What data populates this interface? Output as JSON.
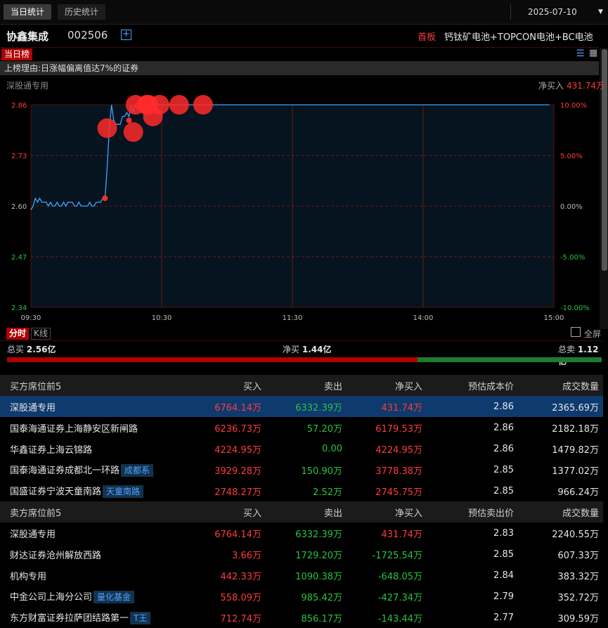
{
  "tabs": {
    "today": "当日统计",
    "history": "历史统计"
  },
  "date": "2025-07-10",
  "stock": {
    "name": "协鑫集成",
    "code": "002506",
    "board_label": "首板",
    "concepts": "钙钛矿电池+TOPCON电池+BC电池"
  },
  "list_tag": "当日榜",
  "reason": "上榜理由:日涨幅偏离值达7%的证券",
  "chart_header": {
    "trader": "深股通专用",
    "net_label": "净买入",
    "net_value": "431.74万"
  },
  "chart_data": {
    "type": "line",
    "x_ticks": [
      "09:30",
      "10:30",
      "11:30",
      "14:00",
      "15:00"
    ],
    "y_ticks_left": [
      "2.86",
      "2.73",
      "2.60",
      "2.47",
      "2.34"
    ],
    "y_ticks_right": [
      "10.00%",
      "5.00%",
      "0.00%",
      "-5.00%",
      "-10.00%"
    ],
    "ylim": [
      2.34,
      2.86
    ],
    "prev_close": 2.6,
    "series": [
      {
        "values": [
          2.59,
          2.6,
          2.62,
          2.61,
          2.62,
          2.61,
          2.61,
          2.61,
          2.6,
          2.61,
          2.6,
          2.6,
          2.61,
          2.6,
          2.6,
          2.61,
          2.6,
          2.61,
          2.61,
          2.61,
          2.6,
          2.6,
          2.61,
          2.6,
          2.6,
          2.6,
          2.6,
          2.61,
          2.6,
          2.6,
          2.61,
          2.61,
          2.61,
          2.62,
          2.62,
          2.7,
          2.8,
          2.86,
          2.82,
          2.81,
          2.81,
          2.81,
          2.83,
          2.83,
          2.84,
          2.83,
          2.86,
          2.84,
          2.86,
          2.85,
          2.86,
          2.85,
          2.86,
          2.86,
          2.86,
          2.86,
          2.85,
          2.86,
          2.86,
          2.86,
          2.86,
          2.86,
          2.86,
          2.86,
          2.86,
          2.86,
          2.86,
          2.86,
          2.86,
          2.86,
          2.86,
          2.86,
          2.86,
          2.86,
          2.86,
          2.86,
          2.86,
          2.86,
          2.86,
          2.86,
          2.86,
          2.86,
          2.86,
          2.86,
          2.86,
          2.86,
          2.86,
          2.86,
          2.86,
          2.86,
          2.86,
          2.86,
          2.86,
          2.86,
          2.86,
          2.86,
          2.86,
          2.86,
          2.86,
          2.86,
          2.86,
          2.86,
          2.86,
          2.86,
          2.86,
          2.86,
          2.86,
          2.86,
          2.86,
          2.86,
          2.86,
          2.86,
          2.86,
          2.86,
          2.86,
          2.86,
          2.86,
          2.86,
          2.86,
          2.86,
          2.86,
          2.86,
          2.86,
          2.86,
          2.86,
          2.86,
          2.86,
          2.86,
          2.86,
          2.86,
          2.86,
          2.86,
          2.86,
          2.86,
          2.86,
          2.86,
          2.86,
          2.86,
          2.86,
          2.86,
          2.86,
          2.86,
          2.86,
          2.86,
          2.86,
          2.86,
          2.86,
          2.86,
          2.86,
          2.86,
          2.86,
          2.86,
          2.86,
          2.86,
          2.86,
          2.86,
          2.86,
          2.86,
          2.86,
          2.86,
          2.86,
          2.86,
          2.86,
          2.86,
          2.86,
          2.86,
          2.86,
          2.86,
          2.86,
          2.86,
          2.86,
          2.86,
          2.86,
          2.86,
          2.86,
          2.86,
          2.86,
          2.86,
          2.86,
          2.86,
          2.86,
          2.86,
          2.86,
          2.86,
          2.86,
          2.86,
          2.86,
          2.86,
          2.86,
          2.86,
          2.86,
          2.86,
          2.86,
          2.86,
          2.86,
          2.86,
          2.86,
          2.86,
          2.86,
          2.86,
          2.86,
          2.86,
          2.86,
          2.86,
          2.86,
          2.86,
          2.86,
          2.86,
          2.86,
          2.86,
          2.86,
          2.86,
          2.86,
          2.86,
          2.86,
          2.86,
          2.86,
          2.86,
          2.86,
          2.86,
          2.86,
          2.86,
          2.86,
          2.86,
          2.86,
          2.86,
          2.86,
          2.86,
          2.86,
          2.86,
          2.86,
          2.86,
          2.86,
          2.86,
          2.86,
          2.86,
          2.86,
          2.86,
          2.86
        ]
      }
    ],
    "markers": [
      {
        "i": 34,
        "v": 2.62,
        "size": "s"
      },
      {
        "i": 35,
        "v": 2.8,
        "size": "l"
      },
      {
        "i": 45,
        "v": 2.82,
        "size": "s"
      },
      {
        "i": 47,
        "v": 2.79,
        "size": "l"
      },
      {
        "i": 48,
        "v": 2.86,
        "size": "l"
      },
      {
        "i": 53,
        "v": 2.86,
        "size": "l"
      },
      {
        "i": 54,
        "v": 2.86,
        "size": "l"
      },
      {
        "i": 56,
        "v": 2.83,
        "size": "l"
      },
      {
        "i": 59,
        "v": 2.86,
        "size": "l"
      },
      {
        "i": 68,
        "v": 2.86,
        "size": "l"
      },
      {
        "i": 79,
        "v": 2.86,
        "size": "l"
      }
    ]
  },
  "chart_tabs": {
    "intraday": "分时",
    "kline": "K线",
    "fullscreen": "全屏"
  },
  "totals": {
    "buy_label": "总买",
    "buy_value": "2.56亿",
    "net_label": "净买",
    "net_value": "1.44亿",
    "sell_label": "总卖",
    "sell_value": "1.12亿",
    "buy_ratio": 0.69
  },
  "buy_table": {
    "headers": [
      "买方席位前5",
      "买入",
      "卖出",
      "净买入",
      "预估成本价",
      "成交数量"
    ],
    "rows": [
      {
        "name": "深股通专用",
        "badge": "",
        "buy": "6764.14万",
        "sell": "6332.39万",
        "net": "431.74万",
        "price": "2.86",
        "vol": "2365.69万",
        "selected": true
      },
      {
        "name": "国泰海通证券上海静安区新闸路",
        "badge": "",
        "buy": "6236.73万",
        "sell": "57.20万",
        "net": "6179.53万",
        "price": "2.86",
        "vol": "2182.18万"
      },
      {
        "name": "华鑫证券上海云锦路",
        "badge": "",
        "buy": "4224.95万",
        "sell": "0.00",
        "net": "4224.95万",
        "price": "2.86",
        "vol": "1479.82万"
      },
      {
        "name": "国泰海通证券成都北一环路",
        "badge": "成都系",
        "buy": "3929.28万",
        "sell": "150.90万",
        "net": "3778.38万",
        "price": "2.85",
        "vol": "1377.02万"
      },
      {
        "name": "国盛证券宁波天童南路",
        "badge": "天童南路",
        "buy": "2748.27万",
        "sell": "2.52万",
        "net": "2745.75万",
        "price": "2.85",
        "vol": "966.24万"
      }
    ]
  },
  "sell_table": {
    "headers": [
      "卖方席位前5",
      "买入",
      "卖出",
      "净买入",
      "预估卖出价",
      "成交数量"
    ],
    "rows": [
      {
        "name": "深股通专用",
        "badge": "",
        "buy": "6764.14万",
        "sell": "6332.39万",
        "net": "431.74万",
        "price": "2.83",
        "vol": "2240.55万"
      },
      {
        "name": "财达证券沧州解放西路",
        "badge": "",
        "buy": "3.66万",
        "sell": "1729.20万",
        "net": "-1725.54万",
        "price": "2.85",
        "vol": "607.33万"
      },
      {
        "name": "机构专用",
        "badge": "",
        "buy": "442.33万",
        "sell": "1090.38万",
        "net": "-648.05万",
        "price": "2.84",
        "vol": "383.32万"
      },
      {
        "name": "中金公司上海分公司",
        "badge": "量化基金",
        "buy": "558.09万",
        "sell": "985.42万",
        "net": "-427.34万",
        "price": "2.79",
        "vol": "352.72万"
      },
      {
        "name": "东方财富证券拉萨团结路第一",
        "badge": "T王",
        "buy": "712.74万",
        "sell": "856.17万",
        "net": "-143.44万",
        "price": "2.77",
        "vol": "309.59万"
      }
    ]
  }
}
